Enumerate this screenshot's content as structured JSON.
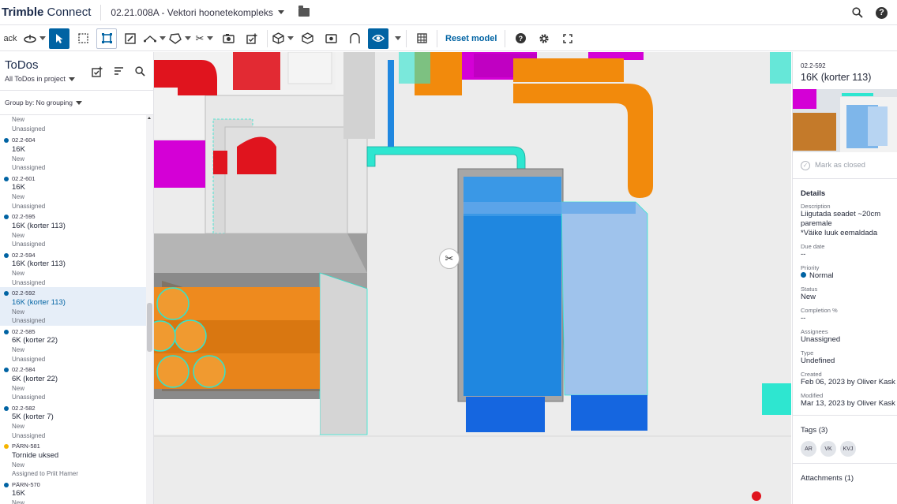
{
  "topbar": {
    "brand_bold": "Trimble",
    "brand_light": " Connect",
    "project": "02.21.008A - Vektori hoonetekompleks",
    "icons": [
      "folder-icon",
      "search-icon",
      "help-icon"
    ]
  },
  "toolbar": {
    "back_label": "ack",
    "reset_model_label": "Reset model",
    "help_glyph": "?"
  },
  "todos": {
    "title": "ToDos",
    "filter": "All ToDos in project",
    "group_by": "Group by: No grouping",
    "items": [
      {
        "code": "",
        "name": "",
        "status": "New",
        "assignee": "Unassigned",
        "dot": "",
        "partial": true
      },
      {
        "code": "02.2-604",
        "name": "16K",
        "status": "New",
        "assignee": "Unassigned",
        "dot": "#0063a3"
      },
      {
        "code": "02.2-601",
        "name": "16K",
        "status": "New",
        "assignee": "Unassigned",
        "dot": "#0063a3"
      },
      {
        "code": "02.2-595",
        "name": "16K (korter 113)",
        "status": "New",
        "assignee": "Unassigned",
        "dot": "#0063a3"
      },
      {
        "code": "02.2-594",
        "name": "16K (korter 113)",
        "status": "New",
        "assignee": "Unassigned",
        "dot": "#0063a3"
      },
      {
        "code": "02.2-592",
        "name": "16K (korter 113)",
        "status": "New",
        "assignee": "Unassigned",
        "dot": "#0063a3",
        "selected": true
      },
      {
        "code": "02.2-585",
        "name": "6K (korter 22)",
        "status": "New",
        "assignee": "Unassigned",
        "dot": "#0063a3"
      },
      {
        "code": "02.2-584",
        "name": "6K (korter 22)",
        "status": "New",
        "assignee": "Unassigned",
        "dot": "#0063a3"
      },
      {
        "code": "02.2-582",
        "name": "5K (korter 7)",
        "status": "New",
        "assignee": "Unassigned",
        "dot": "#0063a3"
      },
      {
        "code": "PÄRN-581",
        "name": "Tornide uksed",
        "status": "New",
        "assignee": "Assigned to Priit Hamer",
        "dot": "#f5b400"
      },
      {
        "code": "PÄRN-570",
        "name": "16K",
        "status": "New",
        "assignee": "",
        "dot": "#0063a3"
      }
    ]
  },
  "details": {
    "code": "02.2-592",
    "title": "16K (korter 113)",
    "mark_closed": "Mark as closed",
    "section": "Details",
    "fields": [
      {
        "label": "Description",
        "value": "Liigutada seadet ~20cm paremale\n*Väike luuk eemaldada"
      },
      {
        "label": "Due date",
        "value": "--"
      },
      {
        "label": "Priority",
        "value": "Normal",
        "dot": true
      },
      {
        "label": "Status",
        "value": "New"
      },
      {
        "label": "Completion %",
        "value": "--"
      },
      {
        "label": "Assignees",
        "value": "Unassigned"
      },
      {
        "label": "Type",
        "value": "Undefined"
      },
      {
        "label": "Created",
        "value": "Feb 06, 2023 by Oliver Kask"
      },
      {
        "label": "Modified",
        "value": "Mar 13, 2023 by Oliver Kask"
      }
    ],
    "tags_title": "Tags (3)",
    "tags": [
      "AR",
      "VK",
      "KVJ"
    ],
    "attachments_title": "Attachments (1)"
  },
  "colors": {
    "accent": "#0063a3",
    "pipe_red": "#e0141e",
    "pipe_magenta": "#d400d6",
    "pipe_orange": "#f28a0c",
    "pipe_cyan": "#2ee6d0",
    "tank_blue": "#1f87e0"
  }
}
